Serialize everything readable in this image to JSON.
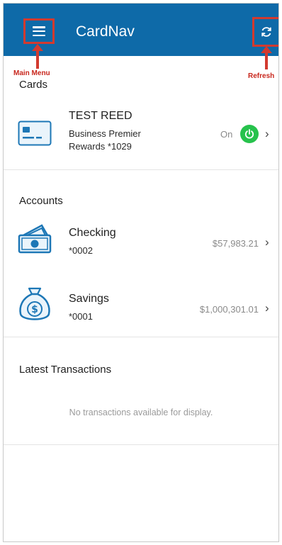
{
  "header": {
    "title": "CardNav"
  },
  "annotations": {
    "main_menu": "Main Menu",
    "refresh": "Refresh"
  },
  "cards": {
    "title": "Cards",
    "items": [
      {
        "name": "TEST REED",
        "line1": "Business Premier",
        "line2": "Rewards *1029",
        "status": "On"
      }
    ]
  },
  "accounts": {
    "title": "Accounts",
    "items": [
      {
        "name": "Checking",
        "number": "*0002",
        "balance": "$57,983.21"
      },
      {
        "name": "Savings",
        "number": "*0001",
        "balance": "$1,000,301.01"
      }
    ]
  },
  "transactions": {
    "title": "Latest Transactions",
    "empty_message": "No transactions available for display."
  },
  "icons": {
    "menu": "hamburger-menu-icon",
    "refresh": "refresh-icon",
    "card": "credit-card-icon",
    "power": "power-icon",
    "checking": "cash-stack-icon",
    "savings": "money-bag-icon",
    "chevron": "chevron-right-icon"
  },
  "colors": {
    "header_bg": "#0e6aa8",
    "annotation": "#d23a2f",
    "toggle_on": "#27c24c",
    "icon_blue": "#1d77b6"
  }
}
